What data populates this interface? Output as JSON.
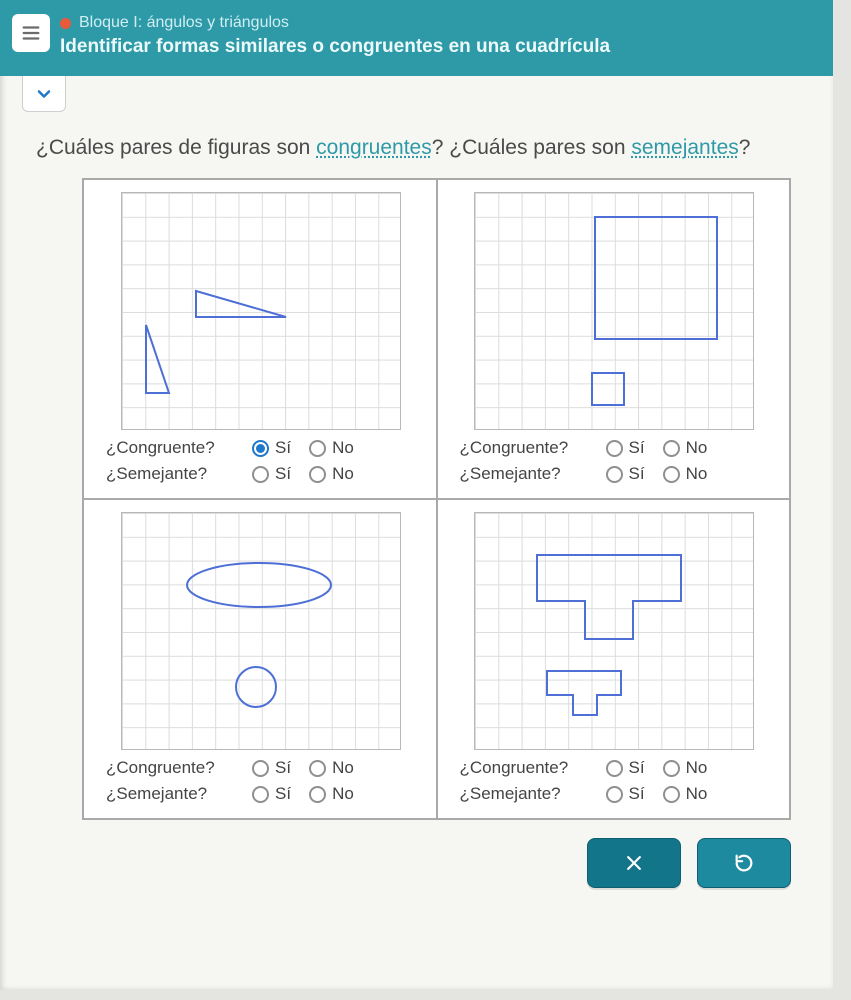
{
  "header": {
    "block": "Bloque I: ángulos y triángulos",
    "title": "Identificar formas similares o congruentes en una cuadrícula"
  },
  "question": {
    "prefix": "¿Cuáles pares de figuras son ",
    "link1": "congruentes",
    "mid": "? ¿Cuáles pares son ",
    "link2": "semejantes",
    "suffix": "?"
  },
  "labels": {
    "congruent": "¿Congruente?",
    "similar": "¿Semejante?",
    "yes": "Sí",
    "no": "No"
  },
  "cells": [
    {
      "id": "triangles",
      "congruent_checked": "yes",
      "similar_checked": null
    },
    {
      "id": "squares",
      "congruent_checked": null,
      "similar_checked": null
    },
    {
      "id": "ovals",
      "congruent_checked": null,
      "similar_checked": null
    },
    {
      "id": "tshapes",
      "congruent_checked": null,
      "similar_checked": null
    }
  ],
  "icons": {
    "menu": "menu-icon",
    "chevron": "chevron-down-icon",
    "close": "close-icon",
    "reset": "reset-icon"
  },
  "colors": {
    "header_bg": "#2e9aa8",
    "shape_stroke": "#4d6fd6",
    "accent": "#1f78c9",
    "button": "#13758a"
  }
}
